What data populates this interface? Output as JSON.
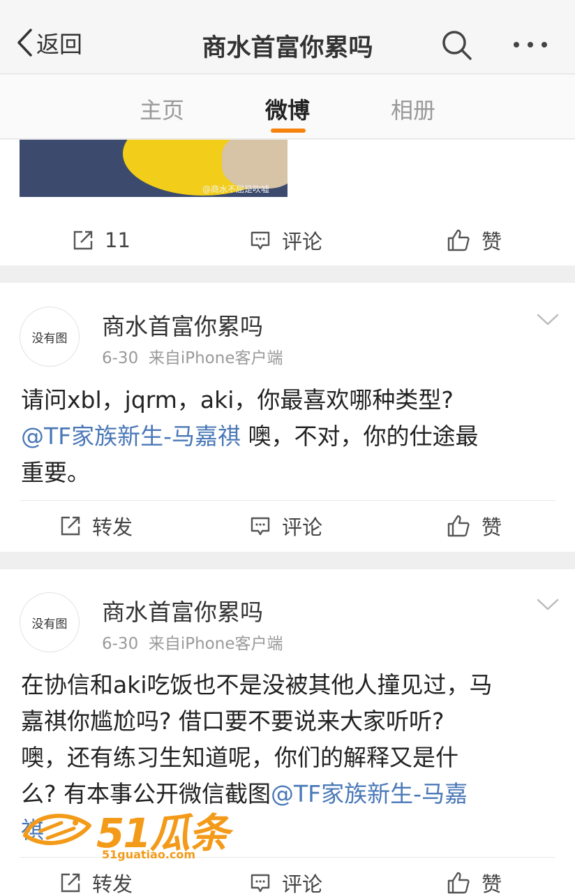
{
  "nav": {
    "back_label": "返回",
    "title": "商水首富你累吗"
  },
  "tabs": [
    {
      "label": "主页"
    },
    {
      "label": "微博"
    },
    {
      "label": "相册"
    }
  ],
  "colors": {
    "accent": "#f5820d",
    "mention": "#4a78b7",
    "watermark": "#f39a19"
  },
  "icons": [
    "chevron-left-icon",
    "search-icon",
    "more-icon",
    "repost-icon",
    "comment-icon",
    "like-icon",
    "chevron-down-icon"
  ],
  "first_card": {
    "image_watermark": "@商水不屈是吹嘘",
    "actions": {
      "repost": "11",
      "comment": "评论",
      "like": "赞"
    }
  },
  "posts": [
    {
      "avatar_text": "没有图",
      "username": "商水首富你累吗",
      "date": "6-30",
      "source": "来自iPhone客户端",
      "text_lines": [
        "请问xbl，jqrm，aki，你最喜欢哪种类型?",
        "@TF家族新生-马嘉祺",
        " 噢，不对，你的仕途最",
        "重要。"
      ],
      "actions": {
        "repost": "转发",
        "comment": "评论",
        "like": "赞"
      }
    },
    {
      "avatar_text": "没有图",
      "username": "商水首富你累吗",
      "date": "6-30",
      "source": "来自iPhone客户端",
      "text_lines": [
        "在协信和aki吃饭也不是没被其他人撞见过，马",
        "嘉祺你尴尬吗? 借口要不要说来大家听听?",
        "噢，还有练习生知道呢，你们的解释又是什",
        "么? 有本事公开微信截图",
        "@TF家族新生-马嘉",
        "祺"
      ],
      "actions": {
        "repost": "转发",
        "comment": "评论",
        "like": "赞"
      }
    }
  ],
  "watermark": {
    "brand": "51瓜条",
    "url": "51guatiao.com"
  }
}
